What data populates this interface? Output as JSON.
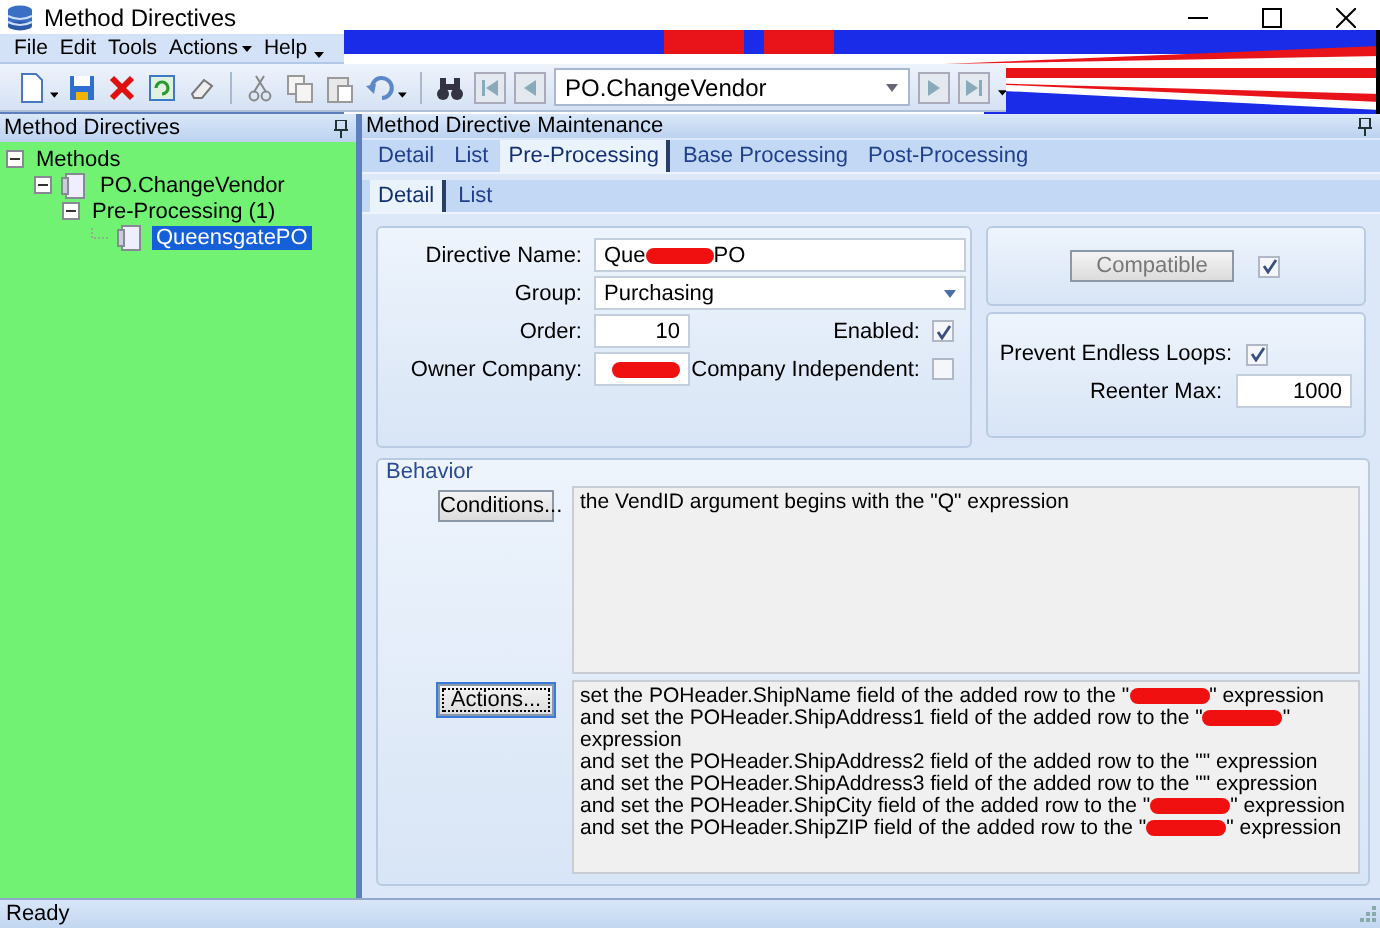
{
  "window": {
    "title": "Method Directives"
  },
  "menu": [
    {
      "label": "File"
    },
    {
      "label": "Edit"
    },
    {
      "label": "Tools"
    },
    {
      "label": "Actions",
      "dropdown": true
    },
    {
      "label": "Help"
    }
  ],
  "toolbar": {
    "record_value": "PO.ChangeVendor"
  },
  "left_panel": {
    "title": "Method Directives",
    "tree": [
      {
        "label": "Methods",
        "expanded": true,
        "selected": false,
        "children": [
          {
            "label": "PO.ChangeVendor",
            "kind": "item",
            "expanded": true,
            "selected": false,
            "children": [
              {
                "label": "Pre-Processing (1)",
                "expanded": true,
                "selected": false,
                "children": [
                  {
                    "label": "QueensgatePO",
                    "kind": "item",
                    "selected": true
                  }
                ]
              }
            ]
          }
        ]
      }
    ]
  },
  "right_panel": {
    "title": "Method Directive Maintenance",
    "tabs": [
      {
        "label": "Detail",
        "selected": false
      },
      {
        "label": "List",
        "selected": false
      },
      {
        "label": "Pre-Processing",
        "selected": true
      },
      {
        "label": "Base Processing",
        "selected": false
      },
      {
        "label": "Post-Processing",
        "selected": false
      }
    ],
    "subtabs": [
      {
        "label": "Detail",
        "selected": true
      },
      {
        "label": "List",
        "selected": false
      }
    ],
    "form": {
      "directive_name": {
        "label": "Directive Name:",
        "value_parts": [
          {
            "kind": "text",
            "text": "Que"
          },
          {
            "kind": "redaction"
          },
          {
            "kind": "text",
            "text": "PO"
          }
        ]
      },
      "group": {
        "label": "Group:",
        "value": "Purchasing"
      },
      "order": {
        "label": "Order:",
        "value": "10"
      },
      "enabled": {
        "label": "Enabled:",
        "checked": true
      },
      "owner_company": {
        "label": "Owner Company:",
        "value_parts": [
          {
            "kind": "redaction"
          }
        ]
      },
      "company_independent": {
        "label": "Company Independent:",
        "checked": false
      },
      "compatible": {
        "label": "Compatible",
        "checked": true
      },
      "prevent_endless_loops": {
        "label": "Prevent Endless Loops:",
        "checked": true
      },
      "reenter_max": {
        "label": "Reenter Max:",
        "value": "1000"
      }
    },
    "behavior": {
      "title": "Behavior",
      "conditions_button": "Conditions...",
      "conditions_text": "the VendID argument begins with the \"Q\" expression",
      "actions_button": "Actions...",
      "actions_lines": [
        [
          {
            "kind": "text",
            "text": "set the POHeader.ShipName field of the added row to the \""
          },
          {
            "kind": "redaction"
          },
          {
            "kind": "text",
            "text": "\" expression"
          }
        ],
        [
          {
            "kind": "text",
            "text": "and set the POHeader.ShipAddress1 field of the added row to the \""
          },
          {
            "kind": "redaction"
          },
          {
            "kind": "text",
            "text": "\""
          }
        ],
        [
          {
            "kind": "text",
            "text": "expression"
          }
        ],
        [
          {
            "kind": "text",
            "text": "and set the POHeader.ShipAddress2 field of the added row to the \"\" expression"
          }
        ],
        [
          {
            "kind": "text",
            "text": "and set the POHeader.ShipAddress3 field of the added row to the \"\" expression"
          }
        ],
        [
          {
            "kind": "text",
            "text": "and set the POHeader.ShipCity field of the added row to the \""
          },
          {
            "kind": "redaction"
          },
          {
            "kind": "text",
            "text": "\" expression"
          }
        ],
        [
          {
            "kind": "text",
            "text": "and set the POHeader.ShipZIP field of the added row to the \""
          },
          {
            "kind": "redaction"
          },
          {
            "kind": "text",
            "text": "\" expression"
          }
        ]
      ]
    }
  },
  "status_bar": {
    "text": "Ready"
  }
}
